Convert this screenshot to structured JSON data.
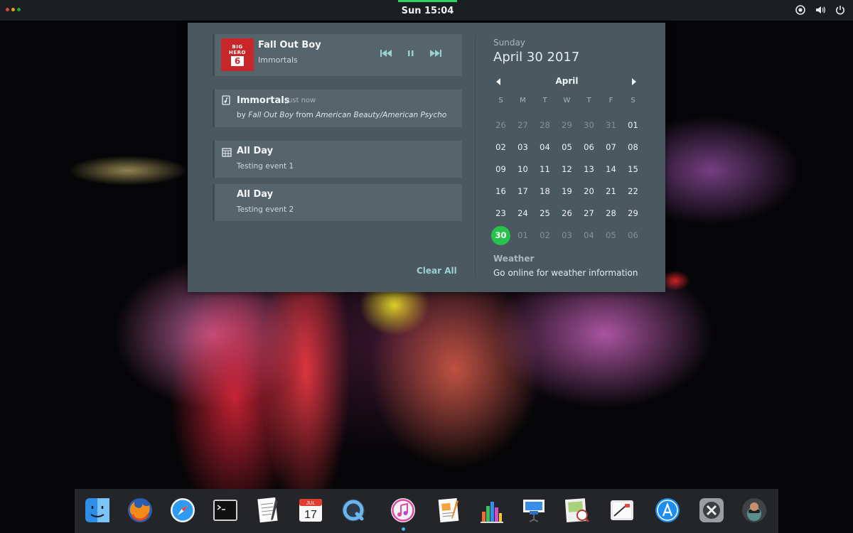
{
  "topbar": {
    "clock": "Sun 15:04",
    "traffic_colors": [
      "#e0443e",
      "#dea123",
      "#1aab29"
    ]
  },
  "media": {
    "title": "Fall Out Boy",
    "subtitle": "Immortals",
    "album_art": [
      "BIG",
      "HERO",
      "6"
    ],
    "controls": [
      "previous-icon",
      "pause-icon",
      "next-icon"
    ]
  },
  "notification": {
    "title": "Immortals",
    "time": "Just now",
    "body_prefix": "by ",
    "artist": "Fall Out Boy",
    "body_mid": " from ",
    "album": "American Beauty/American Psycho"
  },
  "events": [
    {
      "title": "All Day",
      "subtitle": "Testing event 1"
    },
    {
      "title": "All Day",
      "subtitle": "Testing event 2"
    }
  ],
  "clear_all": "Clear All",
  "calendar": {
    "day_name": "Sunday",
    "full_date": "April 30 2017",
    "month": "April",
    "weekdays": [
      "S",
      "M",
      "T",
      "W",
      "T",
      "F",
      "S"
    ],
    "weeks": [
      [
        "26",
        "27",
        "28",
        "29",
        "30",
        "31",
        "01"
      ],
      [
        "02",
        "03",
        "04",
        "05",
        "06",
        "07",
        "08"
      ],
      [
        "09",
        "10",
        "11",
        "12",
        "13",
        "14",
        "15"
      ],
      [
        "16",
        "17",
        "18",
        "19",
        "20",
        "21",
        "22"
      ],
      [
        "23",
        "24",
        "25",
        "26",
        "27",
        "28",
        "29"
      ],
      [
        "30",
        "01",
        "02",
        "03",
        "04",
        "05",
        "06"
      ]
    ],
    "today": "30"
  },
  "weather": {
    "title": "Weather",
    "body": "Go online for weather information"
  },
  "dock": {
    "items": [
      "finder-icon",
      "firefox-icon",
      "safari-icon",
      "terminal-icon",
      "text-editor-icon",
      "calendar-icon",
      "quicktime-icon",
      "itunes-icon",
      "pages-icon",
      "numbers-icon",
      "keynote-icon",
      "preview-icon",
      "screenshot-icon",
      "app-store-icon",
      "system-settings-icon",
      "user-avatar-icon"
    ],
    "calendar_icon_month": "JUL",
    "calendar_icon_day": "17"
  }
}
